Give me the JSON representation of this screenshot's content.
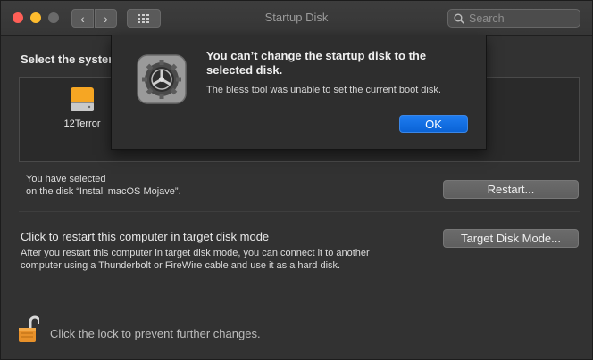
{
  "window": {
    "title": "Startup Disk",
    "search_placeholder": "Search",
    "nav_back_icon": "chevron-left-icon",
    "nav_forward_icon": "chevron-right-icon",
    "grid_icon": "grid-icon"
  },
  "main": {
    "section_title": "Select the system",
    "disks": [
      {
        "label": "12Terror",
        "icon": "internal-disk-icon"
      }
    ],
    "selected_line1": "You have selected",
    "selected_line2": "on the disk “Install macOS Mojave”.",
    "restart_label": "Restart...",
    "target_title": "Click to restart this computer in target disk mode",
    "target_desc": "After you restart this computer in target disk mode, you can connect it to another computer using a Thunderbolt or FireWire cable and use it as a hard disk.",
    "target_button": "Target Disk Mode...",
    "lock_text": "Click the lock to prevent further changes."
  },
  "alert": {
    "icon": "system-preferences-gear-icon",
    "title": "You can’t change the startup disk to the selected disk.",
    "message": "The bless tool was unable to set the current boot disk.",
    "ok_label": "OK"
  },
  "colors": {
    "accent": "#0a63d6",
    "disk_orange": "#f5a623",
    "lock_orange": "#e8912a"
  }
}
